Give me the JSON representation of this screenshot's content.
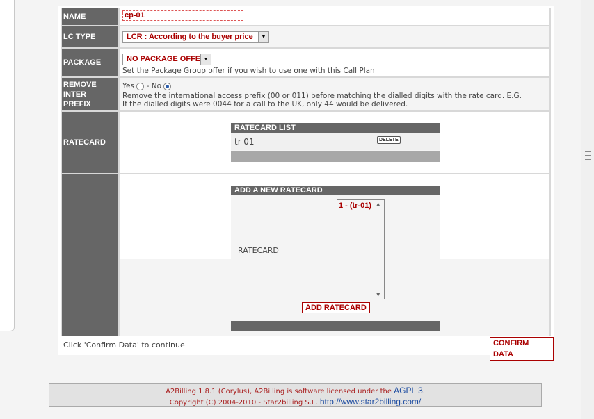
{
  "form": {
    "name": {
      "label": "NAME",
      "value": "cp-01"
    },
    "lc_type": {
      "label": "LC TYPE",
      "selected": "LCR : According to the buyer price"
    },
    "package": {
      "label": "PACKAGE",
      "selected": "NO PACKAGE OFFER",
      "help": "Set the Package Group offer if you wish to use one with this Call Plan"
    },
    "remove_prefix": {
      "label_line1": "REMOVE INTER",
      "label_line2": "PREFIX",
      "yes_label": "Yes",
      "no_label": "- No",
      "selected": "No",
      "help_line1": "Remove the international access prefix (00 or 011) before matching the dialled digits with the rate card. E.G.",
      "help_line2": "If the dialled digits were 0044 for a call to the UK, only 44 would be delivered."
    },
    "ratecard": {
      "label": "RATECARD",
      "list_title": "RATECARD LIST",
      "items": [
        {
          "name": "tr-01",
          "delete_label": "DELETE"
        }
      ]
    },
    "add_ratecard": {
      "title": "ADD A NEW RATECARD",
      "field_label": "RATECARD",
      "options": [
        "1 - (tr-01)"
      ],
      "button_label": "ADD RATECARD"
    }
  },
  "actions": {
    "hint": "Click 'Confirm Data' to continue",
    "confirm_label": "CONFIRM DATA"
  },
  "footer": {
    "line1_text": "A2Billing 1.8.1 (Corylus), A2Billing is software licensed under the",
    "license_link": "AGPL 3",
    "line1_end": ".",
    "line2_text": "Copyright (C) 2004-2010 - Star2billing S.L.",
    "site_link": "http://www.star2billing.com/"
  }
}
